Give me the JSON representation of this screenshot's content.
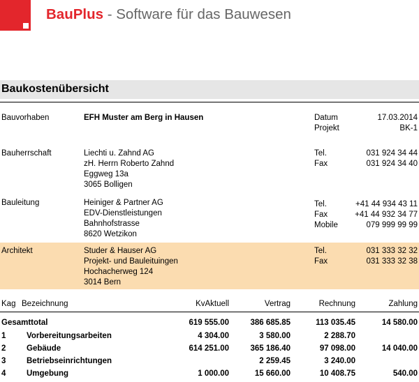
{
  "header": {
    "brand_name": "BauPlus",
    "brand_separator": " - ",
    "brand_tagline": "Software für das Bauwesen",
    "brand_color": "#e3262c"
  },
  "title": "Baukostenübersicht",
  "project": {
    "label": "Bauvorhaben",
    "value": "EFH Muster am Berg in Hausen",
    "datum_label": "Datum",
    "datum_value": "17.03.2014",
    "projekt_label": "Projekt",
    "projekt_value": "BK-1"
  },
  "contacts": [
    {
      "label": "Bauherrschaft",
      "lines": [
        "Liechti u. Zahnd AG",
        "zH. Herrn Roberto Zahnd",
        "Eggweg 13a",
        "3065 Bolligen"
      ],
      "phones": [
        {
          "label": "Tel.",
          "value": "031 924 34 44"
        },
        {
          "label": "Fax",
          "value": "031 924 34 40"
        }
      ]
    },
    {
      "label": "Bauleitung",
      "lines": [
        "Heiniger & Partner AG",
        "EDV-Dienstleistungen",
        "Bahnhofstrasse",
        "8620 Wetzikon"
      ],
      "phones": [
        {
          "label": "Tel.",
          "value": "+41 44 934 43 11"
        },
        {
          "label": "Fax",
          "value": "+41 44 932 34 77"
        },
        {
          "label": "Mobile",
          "value": "079 999 99 99"
        }
      ]
    },
    {
      "label": "Architekt",
      "lines": [
        "Studer & Hauser AG",
        "Projekt- und Bauleituingen",
        "Hochacherweg 124",
        "3014 Bern"
      ],
      "phones": [
        {
          "label": "Tel.",
          "value": "031 333 32 32"
        },
        {
          "label": "Fax",
          "value": "031 333 32 38"
        }
      ]
    }
  ],
  "table": {
    "headers": [
      "Kag",
      "Bezeichnung",
      "KvAktuell",
      "Vertrag",
      "Rechnung",
      "Zahlung"
    ],
    "total": {
      "label": "Gesamttotal",
      "kv": "619 555.00",
      "vertrag": "386 685.85",
      "rechnung": "113 035.45",
      "zahlung": "14 580.00"
    },
    "rows": [
      {
        "kag": "1",
        "bez": "Vorbereitungsarbeiten",
        "kv": "4 304.00",
        "vertrag": "3 580.00",
        "rechnung": "2 288.70",
        "zahlung": ""
      },
      {
        "kag": "2",
        "bez": "Gebäude",
        "kv": "614 251.00",
        "vertrag": "365 186.40",
        "rechnung": "97 098.00",
        "zahlung": "14 040.00"
      },
      {
        "kag": "3",
        "bez": "Betriebseinrichtungen",
        "kv": "",
        "vertrag": "2 259.45",
        "rechnung": "3 240.00",
        "zahlung": ""
      },
      {
        "kag": "4",
        "bez": "Umgebung",
        "kv": "1 000.00",
        "vertrag": "15 660.00",
        "rechnung": "10 408.75",
        "zahlung": "540.00"
      }
    ]
  }
}
